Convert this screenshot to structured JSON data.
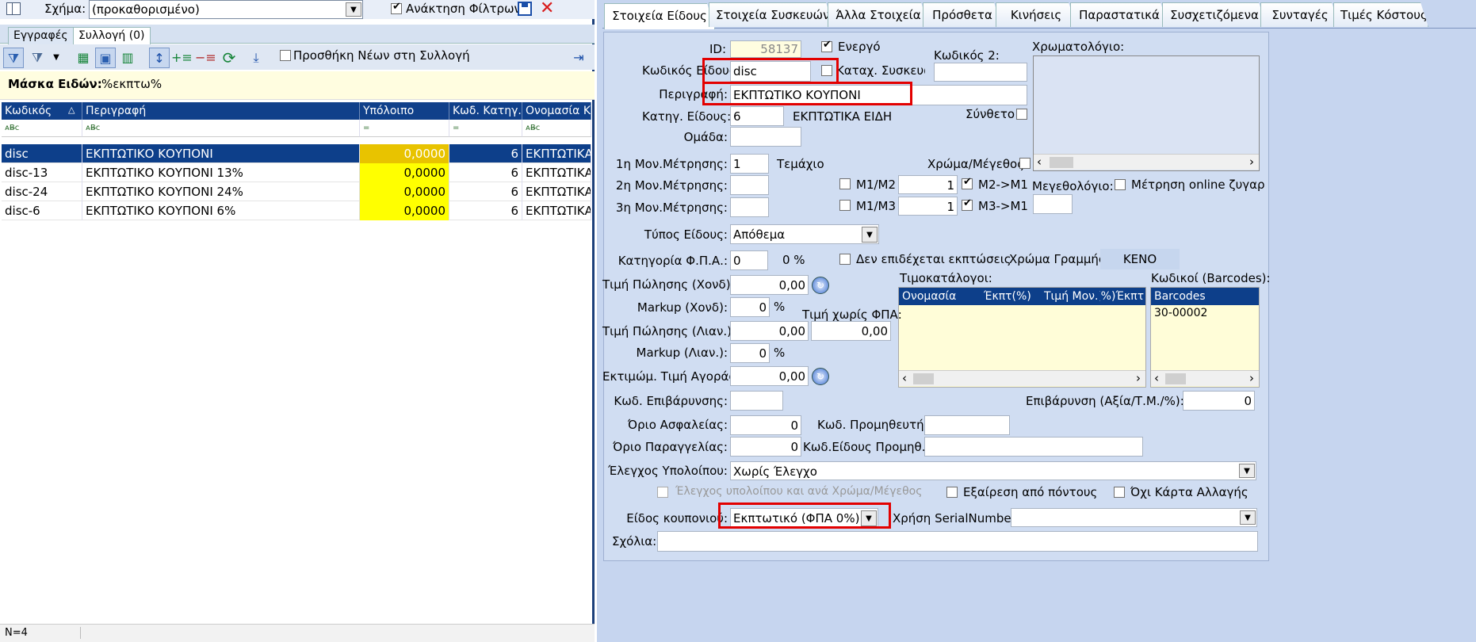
{
  "left": {
    "schema_label": "Σχήμα:",
    "schema_value": "(προκαθορισμένο)",
    "filter_label": "Ανάκτηση Φίλτρων",
    "tab_entries": "Εγγραφές",
    "tab_collection": "Συλλογή (0)",
    "add_new_label": "Προσθήκη Νέων στη Συλλογή",
    "mask_label": "Μάσκα Ειδών:",
    "mask_value": "%εκπτω%",
    "columns": [
      "Κωδικός",
      "Περιγραφή",
      "Υπόλοιπο",
      "Κωδ. Κατηγ.",
      "Ονομασία Κα"
    ],
    "filter_row": [
      "ᴀB̶c",
      "ᴀB̶c",
      "=",
      "=",
      "ᴀB̶c"
    ],
    "rows": [
      {
        "code": "disc",
        "desc": "ΕΚΠΤΩΤΙΚΟ ΚΟΥΠΟΝΙ",
        "balance": "0,0000",
        "cat": "6",
        "catname": "ΕΚΠΤΩΤΙΚΑ"
      },
      {
        "code": "disc-13",
        "desc": "ΕΚΠΤΩΤΙΚΟ ΚΟΥΠΟΝΙ 13%",
        "balance": "0,0000",
        "cat": "6",
        "catname": "ΕΚΠΤΩΤΙΚΑ"
      },
      {
        "code": "disc-24",
        "desc": "ΕΚΠΤΩΤΙΚΟ ΚΟΥΠΟΝΙ 24%",
        "balance": "0,0000",
        "cat": "6",
        "catname": "ΕΚΠΤΩΤΙΚΑ"
      },
      {
        "code": "disc-6",
        "desc": "ΕΚΠΤΩΤΙΚΟ ΚΟΥΠΟΝΙ 6%",
        "balance": "0,0000",
        "cat": "6",
        "catname": "ΕΚΠΤΩΤΙΚΑ"
      }
    ],
    "status": "N=4"
  },
  "tabs": [
    "Στοιχεία Είδους",
    "Στοιχεία Συσκευών",
    "Άλλα Στοιχεία",
    "Πρόσθετα",
    "Κινήσεις",
    "Παραστατικά",
    "Συσχετιζόμενα",
    "Συνταγές",
    "Τιμές Κόστους"
  ],
  "form": {
    "id_label": "ID:",
    "id_value": "58137",
    "active_label": "Ενεργό",
    "code2_label": "Κωδικός 2:",
    "color_chart_label": "Χρωματολόγιο:",
    "code_label": "Κωδικός Είδους:",
    "code_value": "disc",
    "devices_label": "Καταχ. Συσκευώ",
    "desc_label": "Περιγραφή:",
    "desc_value": "ΕΚΠΤΩΤΙΚΟ ΚΟΥΠΟΝΙ",
    "cat_label": "Κατηγ. Είδους:",
    "cat_value": "6",
    "cat_name": "ΕΚΠΤΩΤΙΚΑ ΕΙΔΗ",
    "composite_label": "Σύνθετο",
    "group_label": "Ομάδα:",
    "unit1_label": "1η Μον.Μέτρησης:",
    "unit1_value": "1",
    "unit1_name": "Τεμάχιο",
    "colorsize_label": "Χρώμα/Μέγεθος",
    "unit2_label": "2η Μον.Μέτρησης:",
    "unit3_label": "3η Μον.Μέτρησης:",
    "m1m2_label": "M1/M2",
    "m1m2_value": "1",
    "m2m1_label": "M2->M1",
    "m1m3_label": "M1/M3",
    "m1m3_value": "1",
    "m3m1_label": "M3->M1",
    "size_chart_label": "Μεγεθολόγιο:",
    "online_scale_label": "Μέτρηση online ζυγαριάς",
    "type_label": "Τύπος Είδους:",
    "type_value": "Απόθεμα",
    "vat_label": "Κατηγορία Φ.Π.Α.:",
    "vat_value": "0",
    "vat_pct": "0 %",
    "no_discount_label": "Δεν επιδέχεται εκπτώσεις",
    "line_color_label": "Χρώμα Γραμμής:",
    "line_color_value": "ΚΕΝΟ",
    "wholesale_label": "Τιμή Πώλησης (Χονδ):",
    "wholesale_value": "0,00",
    "pricelists_label": "Τιμοκατάλογοι:",
    "barcodes_label": "Κωδικοί (Barcodes):",
    "markup_w_label": "Markup (Χονδ):",
    "markup_w_value": "0",
    "pct": "%",
    "price_novat_label": "Τιμή χωρίς ΦΠΑ:",
    "retail_label": "Τιμή Πώλησης (Λιαν.):",
    "retail_value": "0,00",
    "retail_novat_value": "0,00",
    "markup_r_label": "Markup (Λιαν.):",
    "markup_r_value": "0",
    "purchase_label": "Εκτιμώμ. Τιμή Αγοράς:",
    "purchase_value": "0,00",
    "surcharge_code_label": "Κωδ. Επιβάρυνσης:",
    "surcharge_label": "Επιβάρυνση (Αξία/Τ.Μ./%):",
    "surcharge_value": "0",
    "safety_label": "Όριο Ασφαλείας:",
    "safety_value": "0",
    "supplier_label": "Κωδ. Προμηθευτή:",
    "reorder_label": "Όριο Παραγγελίας:",
    "reorder_value": "0",
    "supplier_item_label": "Κωδ.Είδους Προμηθ.:",
    "balance_check_label": "Έλεγχος Υπολοίπου:",
    "balance_check_value": "Χωρίς Έλεγχο",
    "balance_cs_label": "Έλεγχος υπολοίπου και ανά Χρώμα/Μέγεθος",
    "exclude_points_label": "Εξαίρεση από πόντους",
    "no_gift_card_label": "Όχι Κάρτα Αλλαγής",
    "coupon_label": "Είδος κουπονιού:",
    "coupon_value": "Εκπτωτικό (ΦΠΑ 0%)",
    "serial_label": "Χρήση SerialNumber:",
    "comments_label": "Σχόλια:"
  },
  "pricelist_columns": [
    "Ονομασία",
    "Έκπτ(%)",
    "Τιμή Μον.",
    "Έκπτ(%)"
  ],
  "barcode_columns": [
    "Barcodes"
  ],
  "barcodes": [
    "30-00002"
  ]
}
